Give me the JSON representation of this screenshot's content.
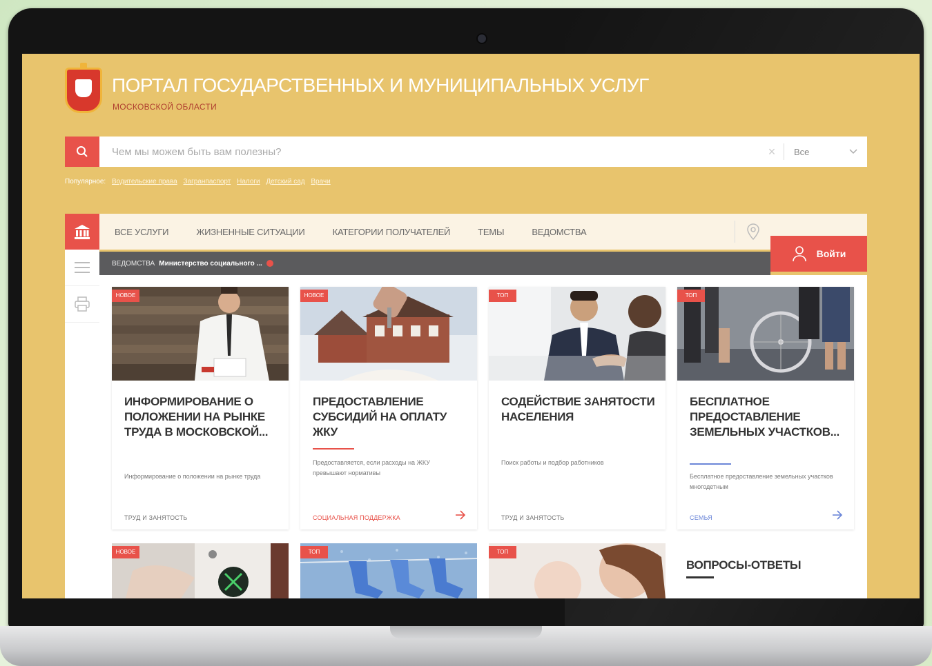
{
  "header": {
    "title": "ПОРТАЛ ГОСУДАРСТВЕННЫХ И МУНИЦИПАЛЬНЫХ УСЛУГ",
    "subtitle": "МОСКОВСКОЙ ОБЛАСТИ"
  },
  "search": {
    "placeholder": "Чем мы можем быть вам полезны?",
    "scope": "Все"
  },
  "popular": {
    "label": "Популярное:",
    "links": [
      "Водительские права",
      "Загранпаспорт",
      "Налоги",
      "Детский сад",
      "Врачи"
    ]
  },
  "nav": {
    "items": [
      "ВСЕ УСЛУГИ",
      "ЖИЗНЕННЫЕ СИТУАЦИИ",
      "КАТЕГОРИИ ПОЛУЧАТЕЛЕЙ",
      "ТЕМЫ",
      "ВЕДОМСТВА"
    ],
    "login": "Войти"
  },
  "breadcrumb": {
    "prefix": "ВЕДОМСТВА",
    "current": "Министерство социального ..."
  },
  "cards": [
    {
      "tag": "НОВОЕ",
      "title": "ИНФОРМИРОВАНИЕ О ПОЛОЖЕНИИ НА РЫНКЕ ТРУДА В МОСКОВСКОЙ...",
      "description": "Информирование о положении на рынке труда",
      "category": "ТРУД И ЗАНЯТОСТЬ"
    },
    {
      "tag": "НОВОЕ",
      "title": "ПРЕДОСТАВЛЕНИЕ СУБСИДИЙ НА ОПЛАТУ ЖКУ",
      "description": "Предоставляется, если расходы на ЖКУ превышают нормативы",
      "category": "СОЦИАЛЬНАЯ ПОДДЕРЖКА"
    },
    {
      "tag": "ТОП",
      "title": "СОДЕЙСТВИЕ ЗАНЯТОСТИ НАСЕЛЕНИЯ",
      "description": "Поиск работы и подбор работников",
      "category": "ТРУД И ЗАНЯТОСТЬ"
    },
    {
      "tag": "ТОП",
      "title": "БЕСПЛАТНОЕ ПРЕДОСТАВЛЕНИЕ ЗЕМЕЛЬНЫХ УЧАСТКОВ...",
      "description": "Бесплатное предоставление земельных участков многодетным",
      "category": "СЕМЬЯ"
    }
  ],
  "row2_tags": [
    "НОВОЕ",
    "ТОП",
    "ТОП"
  ],
  "faq": {
    "title": "ВОПРОСЫ-ОТВЕТЫ"
  },
  "colors": {
    "accent": "#e8524a",
    "background": "#e8c46d",
    "blue_accent": "#6b86d8"
  }
}
